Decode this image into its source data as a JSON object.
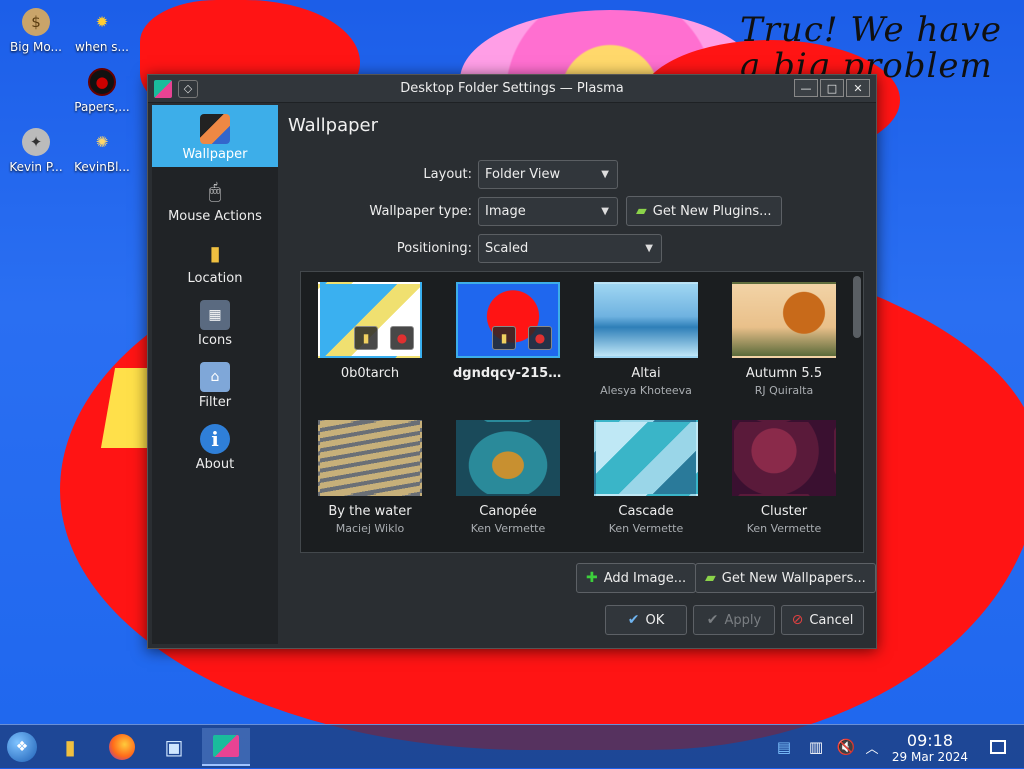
{
  "desktop": {
    "icons": [
      {
        "label": "Big Mo...",
        "icon": "money-bag-icon"
      },
      {
        "label": "when s...",
        "icon": "sun-icon"
      },
      {
        "label": "Papers,...",
        "icon": "papers-icon"
      },
      {
        "label": "Kevin P...",
        "icon": "compass-icon"
      },
      {
        "label": "KevinBl...",
        "icon": "settings-gear-icon"
      }
    ],
    "scribble": "Truc! We have a big problem here"
  },
  "window": {
    "title": "Desktop Folder Settings — Plasma",
    "buttons": {
      "minimize": "—",
      "maximize": "□",
      "close": "✕"
    }
  },
  "sidebar": {
    "items": [
      {
        "label": "Wallpaper",
        "icon": "wallpaper-icon",
        "active": true
      },
      {
        "label": "Mouse Actions",
        "icon": "mouse-icon"
      },
      {
        "label": "Location",
        "icon": "folder-icon"
      },
      {
        "label": "Icons",
        "icon": "icons-icon"
      },
      {
        "label": "Filter",
        "icon": "filter-icon"
      },
      {
        "label": "About",
        "icon": "info-icon"
      }
    ]
  },
  "page": {
    "title": "Wallpaper",
    "layout_label": "Layout:",
    "layout_value": "Folder View",
    "wallpaper_type_label": "Wallpaper type:",
    "wallpaper_type_value": "Image",
    "get_new_plugins": "Get New Plugins...",
    "positioning_label": "Positioning:",
    "positioning_value": "Scaled"
  },
  "wallpapers": [
    {
      "name": "0b0tarch",
      "author": ""
    },
    {
      "name": "dgndqcy-215fc...",
      "author": "",
      "selected": true
    },
    {
      "name": "Altai",
      "author": "Alesya Khoteeva"
    },
    {
      "name": "Autumn 5.5",
      "author": "RJ Quiralta"
    },
    {
      "name": "By the water",
      "author": "Maciej Wiklo"
    },
    {
      "name": "Canopée",
      "author": "Ken Vermette"
    },
    {
      "name": "Cascade",
      "author": "Ken Vermette"
    },
    {
      "name": "Cluster",
      "author": "Ken Vermette"
    }
  ],
  "actions": {
    "add_image": "Add Image...",
    "get_new_wallpapers": "Get New Wallpapers...",
    "ok": "OK",
    "apply": "Apply",
    "cancel": "Cancel"
  },
  "taskbar": {
    "clock_time": "09:18",
    "clock_date": "29 Mar 2024"
  },
  "colors": {
    "accent": "#3daee9",
    "dialog_bg": "#2a2e32",
    "desktop_blue": "#2a6ff2",
    "wallpaper_red": "#ff1414"
  }
}
